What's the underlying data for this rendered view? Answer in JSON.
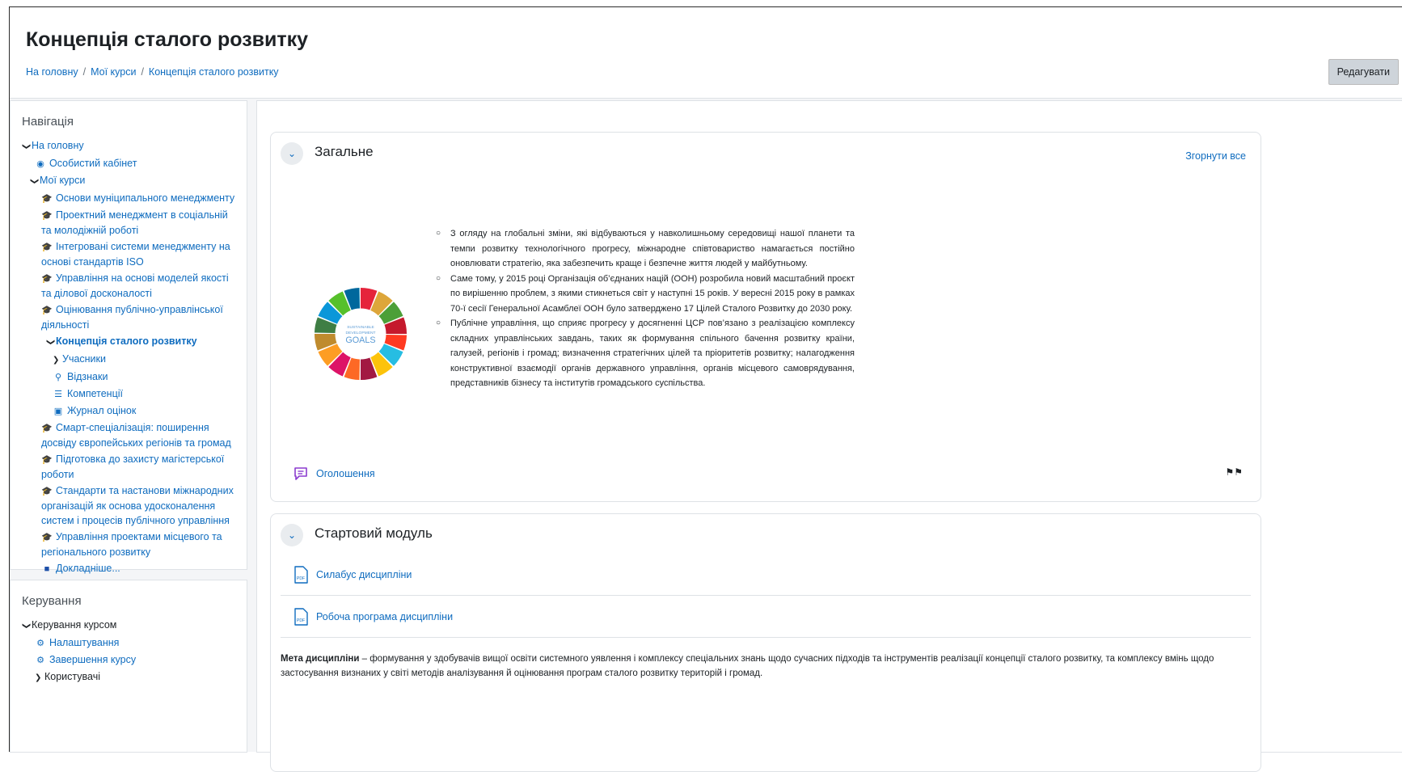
{
  "header": {
    "title": "Концепція сталого розвитку",
    "breadcrumb": [
      "На головну",
      "Мої курси",
      "Концепція сталого розвитку"
    ],
    "edit_label": "Редагувати"
  },
  "nav_block": {
    "title": "Навігація",
    "home": "На головну",
    "dashboard": "Особистий кабінет",
    "my_courses": "Мої курси",
    "courses": [
      "Основи муніципального менеджменту",
      "Проектний менеджмент в соціальній та молодіжній роботі",
      "Інтегровані системи менеджменту на основі стандартів ISO",
      "Управління на основі моделей якості та ділової досконалості",
      "Оцінювання публічно-управлінської діяльності"
    ],
    "current_course": "Концепція сталого розвитку",
    "current_children": [
      "Учасники",
      "Відзнаки",
      "Компетенції",
      "Журнал оцінок"
    ],
    "courses_after": [
      "Смарт-спеціалізація: поширення досвіду європейських регіонів та громад",
      "Підготовка до захисту магістерської роботи",
      "Стандарти та настанови міжнародних організацій як основа удосконалення систем і процесів публічного управління",
      "Управління проектами місцевого та регіонального розвитку"
    ],
    "more": "Докладніше..."
  },
  "admin_block": {
    "title": "Керування",
    "course_admin": "Керування курсом",
    "items": [
      "Налаштування",
      "Завершення курсу"
    ],
    "users": "Користувачі"
  },
  "section_general": {
    "title": "Загальне",
    "collapse_all": "Згорнути все",
    "logo_text": [
      "SUSTAINABLE",
      "DEVELOPMENT",
      "GOALS"
    ],
    "bullets": [
      "З огляду на глобальні зміни, які відбуваються у навколишньому середовищі нашої планети та темпи розвитку технологічного прогресу, міжнародне співтовариство намагається постійно оновлювати стратегію, яка забезпечить краще і безпечне життя людей у майбутньому.",
      "Саме тому, у 2015 році Організація об’єднаних націй (ООН) розробила новий масштабний проєкт по вирішенню проблем, з якими стикнеться світ у наступні 15 років. У вересні 2015 року в рамках 70-ї сесії Генеральної Асамблеї ООН було затверджено 17 Цілей Сталого Розвитку до 2030 року.",
      "Публічне управління, що сприяє прогресу у досягненні ЦСР пов’язано з реалізацією комплексу складних управлінських завдань, таких як формування спільного бачення розвитку країни, галузей, регіонів і громад; визначення стратегічних цілей та пріоритетів розвитку; налагодження конструктивної взаємодії органів державного управління, органів місцевого самоврядування, представників бізнесу та інститутів громадського суспільства."
    ],
    "announcements": "Оголошення"
  },
  "section_start": {
    "title": "Стартовий модуль",
    "activities": [
      "Силабус дисципліни",
      "Робоча програма дисципліни"
    ],
    "aim_label": "Мета дисципліни",
    "aim_text": " – формування у здобувачів вищої освіти системного уявлення і комплексу спеціальних знань щодо сучасних підходів та інструментів реалізації концепції сталого розвитку, та комплексу вмінь щодо застосування визнаних у світі методів аналізування й оцінювання програм сталого розвитку територій і громад."
  },
  "colors": {
    "link": "#0f6cbf",
    "page_bg": "#f4f5f7",
    "border": "#dee2e6",
    "button_bg": "#ced4da"
  }
}
